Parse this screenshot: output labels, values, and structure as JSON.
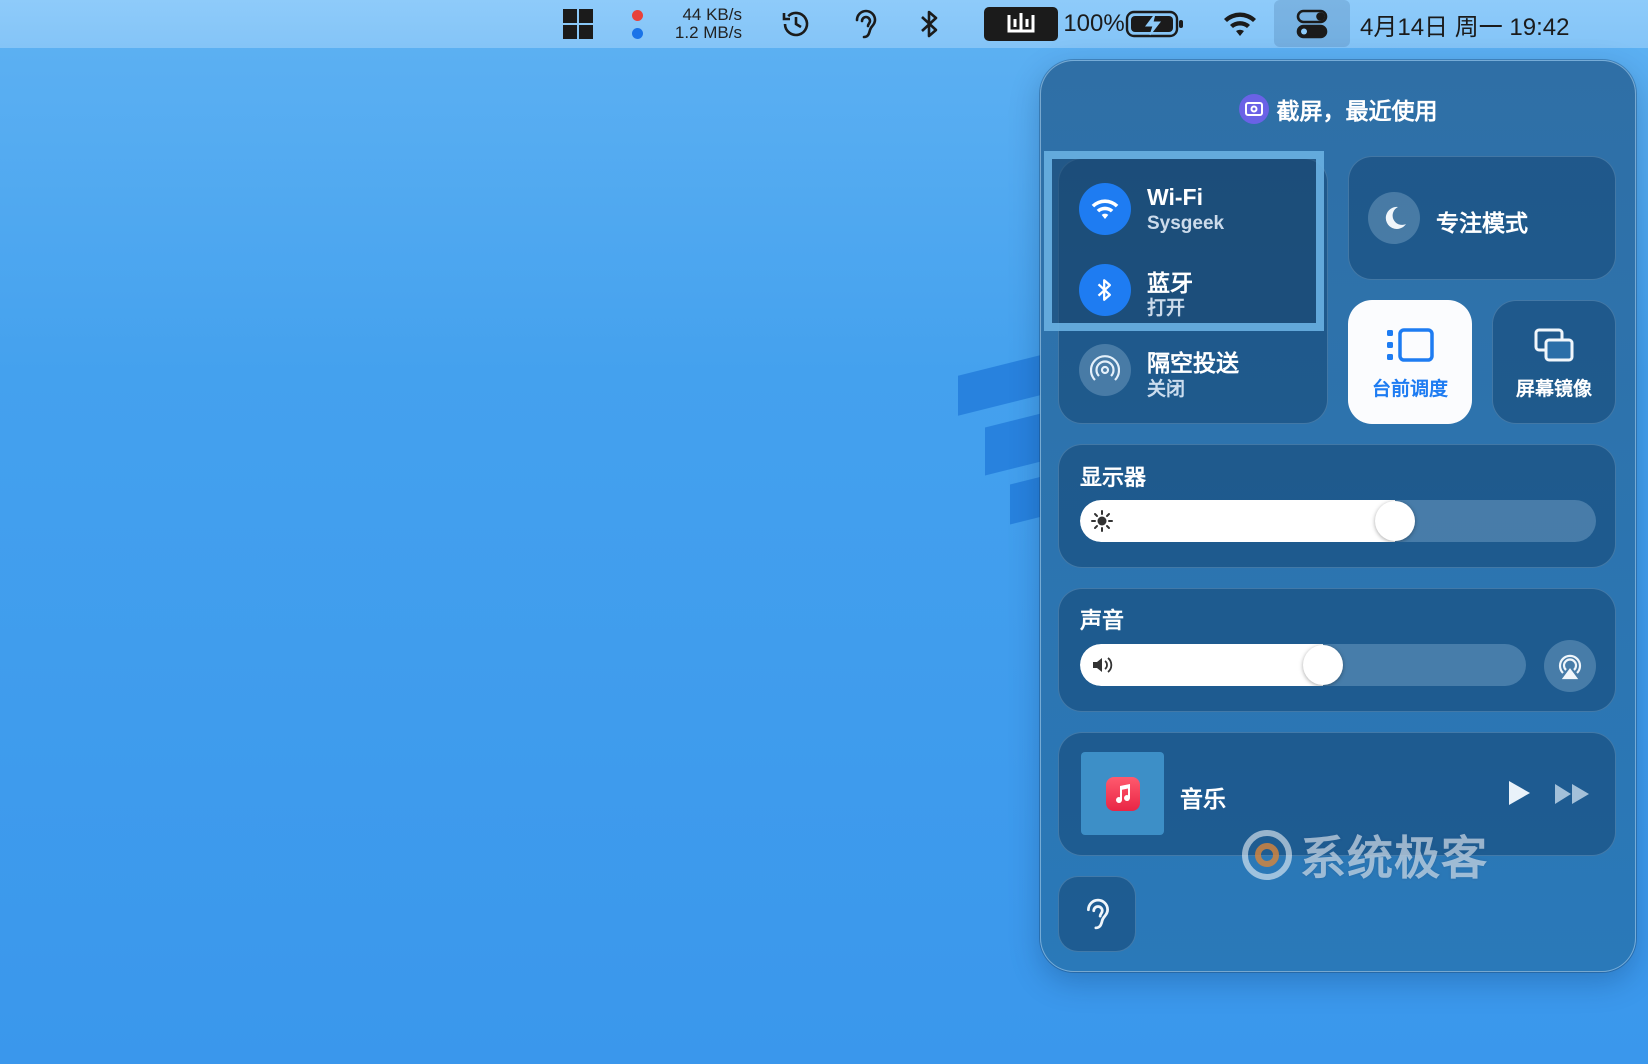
{
  "menubar": {
    "net_upload": "44 KB/s",
    "net_download": "1.2 MB/s",
    "battery": "100%",
    "datetime": "4月14日 周一  19:42",
    "icons": [
      "windows-logo-icon",
      "time-machine-icon",
      "hearing-icon",
      "bluetooth-icon",
      "input-method-icon",
      "battery-charging-icon",
      "wifi-icon",
      "control-center-icon"
    ]
  },
  "control_center": {
    "header": "截屏，最近使用",
    "wifi": {
      "label": "Wi-Fi",
      "status": "Sysgeek"
    },
    "bluetooth": {
      "label": "蓝牙",
      "status": "打开"
    },
    "airdrop": {
      "label": "隔空投送",
      "status": "关闭"
    },
    "focus": {
      "label": "专注模式"
    },
    "stage_manager": {
      "label": "台前调度"
    },
    "screen_mirroring": {
      "label": "屏幕镜像"
    },
    "display": {
      "title": "显示器",
      "level": 0.62
    },
    "sound": {
      "title": "声音",
      "level": 0.55
    },
    "now_playing": {
      "app": "音乐"
    },
    "watermark": "系统极客"
  },
  "colors": {
    "accent": "#1e7cf2",
    "panel": "#2d73ad",
    "menubar": "#8ecbfa"
  }
}
